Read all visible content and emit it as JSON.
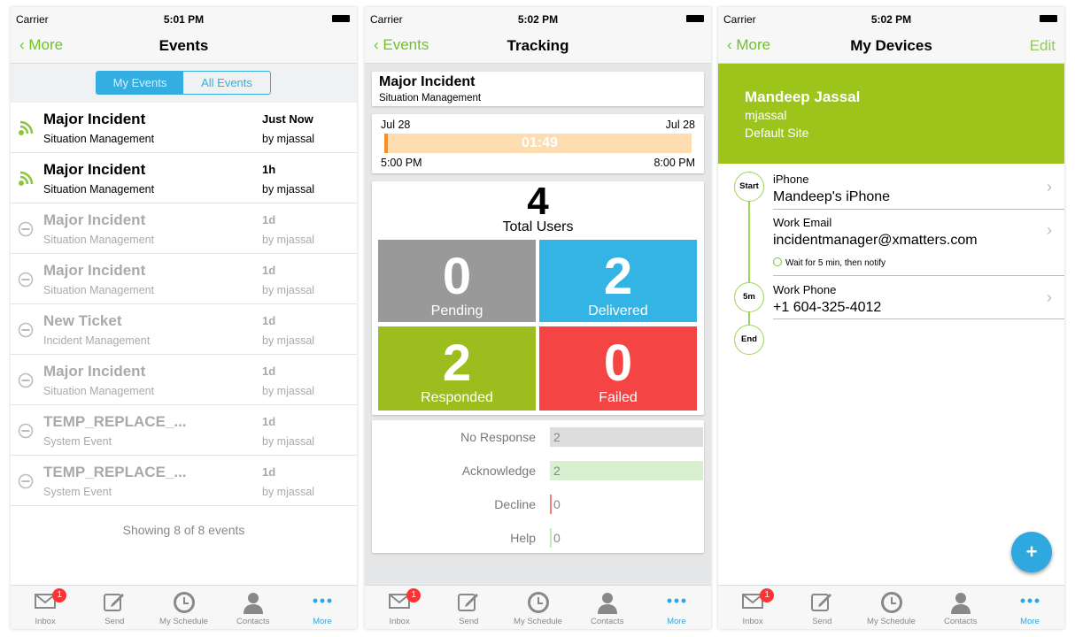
{
  "status": {
    "carrier": "Carrier",
    "times": [
      "5:01 PM",
      "5:02 PM",
      "5:02 PM"
    ]
  },
  "tabbar": {
    "items": [
      {
        "label": "Inbox",
        "icon": "envelope-icon",
        "badge": "1"
      },
      {
        "label": "Send",
        "icon": "compose-icon"
      },
      {
        "label": "My Schedule",
        "icon": "clock-icon"
      },
      {
        "label": "Contacts",
        "icon": "person-icon"
      },
      {
        "label": "More",
        "icon": "more-dots-icon",
        "active": true
      }
    ]
  },
  "events": {
    "back": "More",
    "title": "Events",
    "tabs": [
      "My Events",
      "All Events"
    ],
    "rows": [
      {
        "title": "Major Incident",
        "sub": "Situation Management",
        "when": "Just Now",
        "by": "by mjassal",
        "active": true
      },
      {
        "title": "Major Incident",
        "sub": "Situation Management",
        "when": "1h",
        "by": "by mjassal",
        "active": true
      },
      {
        "title": "Major Incident",
        "sub": "Situation Management",
        "when": "1d",
        "by": "by mjassal",
        "active": false
      },
      {
        "title": "Major Incident",
        "sub": "Situation Management",
        "when": "1d",
        "by": "by mjassal",
        "active": false
      },
      {
        "title": "New Ticket",
        "sub": "Incident Management",
        "when": "1d",
        "by": "by mjassal",
        "active": false
      },
      {
        "title": "Major Incident",
        "sub": "Situation Management",
        "when": "1d",
        "by": "by mjassal",
        "active": false
      },
      {
        "title": "TEMP_REPLACE_...",
        "sub": "System Event",
        "when": "1d",
        "by": "by mjassal",
        "active": false
      },
      {
        "title": "TEMP_REPLACE_...",
        "sub": "System Event",
        "when": "1d",
        "by": "by mjassal",
        "active": false
      }
    ],
    "footer": "Showing 8 of 8 events"
  },
  "tracking": {
    "back": "Events",
    "title": "Tracking",
    "event_title": "Major Incident",
    "event_sub": "Situation Management",
    "start_date": "Jul 28",
    "end_date": "Jul 28",
    "start_time": "5:00 PM",
    "end_time": "8:00 PM",
    "elapsed": "01:49",
    "total": "4",
    "total_label": "Total Users",
    "tiles": [
      {
        "n": "0",
        "l": "Pending",
        "color": "#999999"
      },
      {
        "n": "2",
        "l": "Delivered",
        "color": "#34b4e4"
      },
      {
        "n": "2",
        "l": "Responded",
        "color": "#9bbd1d"
      },
      {
        "n": "0",
        "l": "Failed",
        "color": "#f44444"
      }
    ],
    "responses": [
      {
        "l": "No Response",
        "v": "2",
        "color": "#dddddd"
      },
      {
        "l": "Acknowledge",
        "v": "2",
        "color": "#d8f0d0"
      },
      {
        "l": "Decline",
        "v": "0",
        "color": "#f08080"
      },
      {
        "l": "Help",
        "v": "0",
        "color": "#c8e8c0"
      }
    ]
  },
  "devices": {
    "back": "More",
    "title": "My Devices",
    "edit": "Edit",
    "name": "Mandeep Jassal",
    "user": "mjassal",
    "site": "Default Site",
    "header_color": "#9dc41a",
    "steps": [
      "Start",
      "5m",
      "End"
    ],
    "items": [
      {
        "label": "iPhone",
        "value": "Mandeep's iPhone"
      },
      {
        "label": "Work Email",
        "value": "incidentmanager@xmatters.com"
      },
      {
        "label": "Work Phone",
        "value": "+1 604-325-4012"
      }
    ],
    "wait": "Wait for 5 min, then notify",
    "fab": "+"
  }
}
